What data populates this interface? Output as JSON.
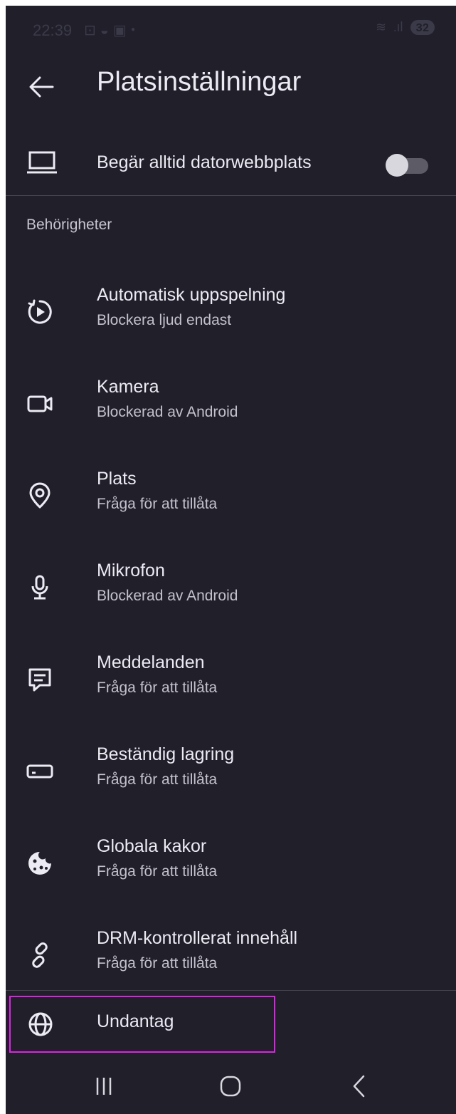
{
  "status_bar": {
    "time": "22:39",
    "battery": "32"
  },
  "header": {
    "title": "Platsinställningar"
  },
  "desktop_setting": {
    "label": "Begär alltid datorwebbplats",
    "enabled": false
  },
  "permissions_section": {
    "title": "Behörigheter",
    "items": [
      {
        "title": "Automatisk uppspelning",
        "subtitle": "Blockera ljud endast",
        "icon": "autoplay-icon"
      },
      {
        "title": "Kamera",
        "subtitle": "Blockerad av Android",
        "icon": "camera-icon"
      },
      {
        "title": "Plats",
        "subtitle": "Fråga för att tillåta",
        "icon": "location-icon"
      },
      {
        "title": "Mikrofon",
        "subtitle": "Blockerad av Android",
        "icon": "microphone-icon"
      },
      {
        "title": "Meddelanden",
        "subtitle": "Fråga för att tillåta",
        "icon": "notification-icon"
      },
      {
        "title": "Beständig lagring",
        "subtitle": "Fråga för att tillåta",
        "icon": "storage-icon"
      },
      {
        "title": "Globala kakor",
        "subtitle": "Fråga för att tillåta",
        "icon": "cookie-icon"
      },
      {
        "title": "DRM-kontrollerat innehåll",
        "subtitle": "Fråga för att tillåta",
        "icon": "drm-icon"
      }
    ]
  },
  "exceptions": {
    "label": "Undantag"
  },
  "colors": {
    "background": "#201f2a",
    "text_primary": "#ecebf3",
    "text_secondary": "#c2c1cc",
    "highlight": "#e020e8"
  }
}
